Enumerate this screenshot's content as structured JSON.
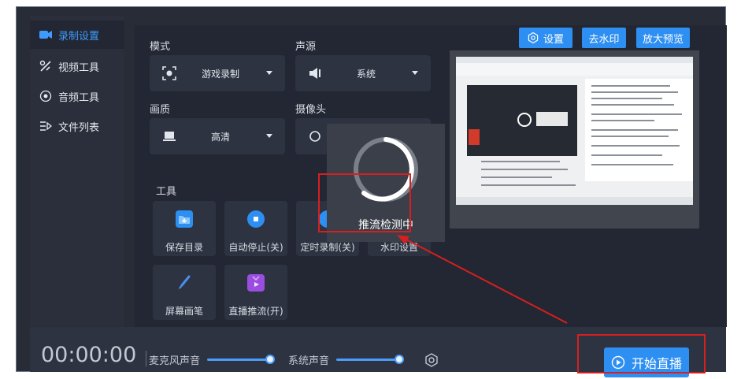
{
  "sidebar": {
    "items": [
      {
        "label": "录制设置",
        "icon": "video-camera-icon"
      },
      {
        "label": "视频工具",
        "icon": "tools-icon"
      },
      {
        "label": "音频工具",
        "icon": "audio-icon"
      },
      {
        "label": "文件列表",
        "icon": "file-list-icon"
      }
    ]
  },
  "top_buttons": {
    "settings": "设置",
    "remove_watermark": "去水印",
    "enlarge_preview": "放大预览"
  },
  "mode": {
    "label": "模式",
    "value": "游戏录制"
  },
  "audio_source": {
    "label": "声源",
    "value": "系统"
  },
  "quality": {
    "label": "画质",
    "value": "高清"
  },
  "camera": {
    "label": "摄像头"
  },
  "tools": {
    "label": "工具",
    "items": [
      {
        "label": "保存目录",
        "icon": "folder-download-icon",
        "color": "#2e8ff2"
      },
      {
        "label": "自动停止(关)",
        "icon": "stop-icon",
        "color": "#2e8ff2"
      },
      {
        "label": "定时录制(关)",
        "icon": "timer-icon",
        "color": "#2e8ff2"
      },
      {
        "label": "水印设置",
        "icon": "watermark-icon",
        "color": "#2e8ff2"
      },
      {
        "label": "屏幕画笔",
        "icon": "brush-icon",
        "color": "#3a7fe0"
      },
      {
        "label": "直播推流(开)",
        "icon": "tv-icon",
        "color": "#9b4de0"
      }
    ]
  },
  "popup": {
    "text": "推流检测中"
  },
  "bottom": {
    "time": "00:00:00",
    "mic_label": "麦克风声音",
    "mic_level": 0.8,
    "system_label": "系统声音",
    "system_level": 0.8,
    "start_button": "开始直播"
  },
  "colors": {
    "accent": "#2e8ff2",
    "annotation": "#d71f1f"
  }
}
